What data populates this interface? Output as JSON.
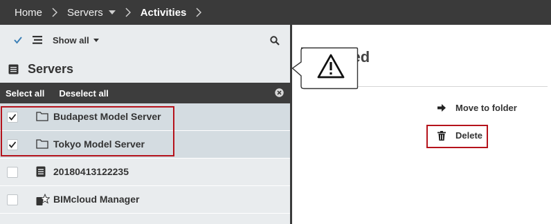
{
  "breadcrumb": {
    "items": [
      {
        "label": "Home",
        "active": false,
        "dropdown": false
      },
      {
        "label": "Servers",
        "active": false,
        "dropdown": true
      },
      {
        "label": "Activities",
        "active": true,
        "dropdown": false
      }
    ]
  },
  "toolbar": {
    "filter_label": "Show all"
  },
  "panel": {
    "title": "Servers",
    "select_all": "Select all",
    "deselect_all": "Deselect all"
  },
  "rows": [
    {
      "label": "Budapest Model Server",
      "checked": true,
      "icon": "folder-icon"
    },
    {
      "label": "Tokyo Model Server",
      "checked": true,
      "icon": "folder-icon"
    },
    {
      "label": "20180413122235",
      "checked": false,
      "icon": "server-icon"
    },
    {
      "label": "BIMcloud Manager",
      "checked": false,
      "icon": "manager-icon"
    }
  ],
  "detail": {
    "title_visible": "cted",
    "actions": {
      "move": "Move to folder",
      "delete": "Delete"
    }
  },
  "colors": {
    "topbar": "#3a3a3a",
    "panel_bg": "#e9ecee",
    "selected_row": "#d4dce1",
    "highlight": "#b5121b",
    "check_accent": "#3b7fb6"
  }
}
